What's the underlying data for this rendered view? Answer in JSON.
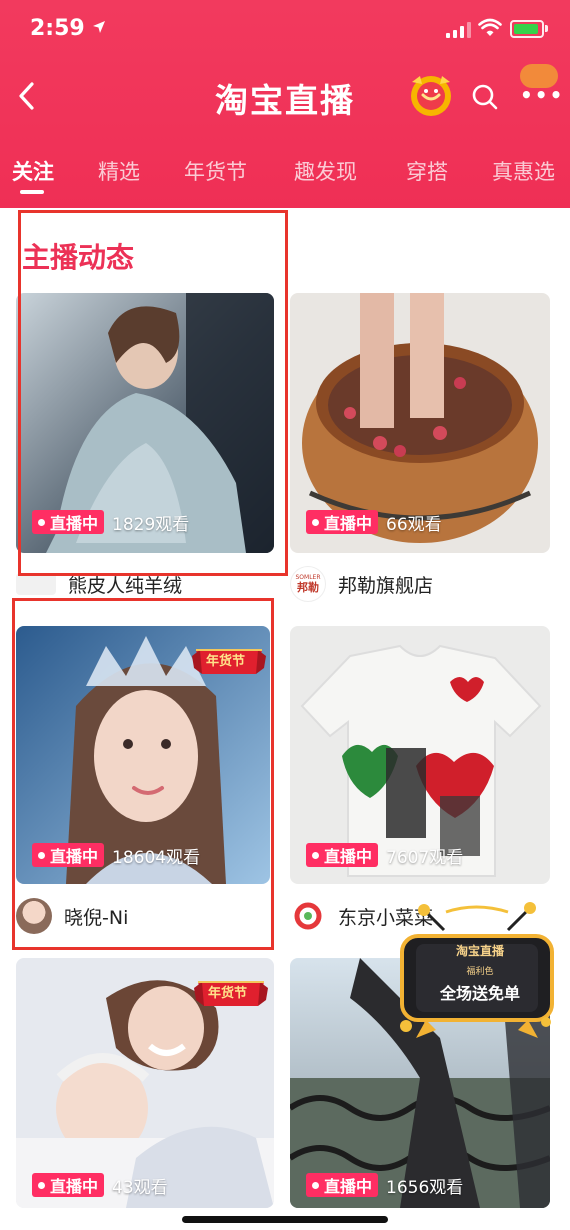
{
  "status_bar": {
    "time": "2:59"
  },
  "header": {
    "title": "淘宝直播",
    "tabs": [
      {
        "label": "关注",
        "active": true
      },
      {
        "label": "精选"
      },
      {
        "label": "年货节"
      },
      {
        "label": "趣发现"
      },
      {
        "label": "穿搭"
      },
      {
        "label": "真惠选"
      }
    ]
  },
  "section": {
    "title": "主播动态"
  },
  "cards": [
    {
      "live_label": "直播中",
      "viewers": "1829观看",
      "anchor": "熊皮人纯羊绒",
      "festival_badge": ""
    },
    {
      "live_label": "直播中",
      "viewers": "66观看",
      "anchor": "邦勒旗舰店",
      "festival_badge": ""
    },
    {
      "live_label": "直播中",
      "viewers": "18604观看",
      "anchor": "晓倪-Ni",
      "festival_badge": "年货节"
    },
    {
      "live_label": "直播中",
      "viewers": "7607观看",
      "anchor": "东京小菜菜",
      "festival_badge": ""
    },
    {
      "live_label": "直播中",
      "viewers": "43观看",
      "anchor": "",
      "festival_badge": "年货节"
    },
    {
      "live_label": "直播中",
      "viewers": "1656观看",
      "anchor": "",
      "festival_badge": ""
    }
  ],
  "logos": {
    "card2_logo_line1": "SOMLER",
    "card2_logo_line2": "邦勒"
  },
  "promo": {
    "logo": "淘宝直播",
    "sub": "福利色",
    "text": "全场送免单"
  },
  "colors": {
    "brand": "#f23a5e",
    "live_pill": "#ff2e63",
    "section_title": "#ec3156",
    "annotation_box": "#e8342c"
  }
}
